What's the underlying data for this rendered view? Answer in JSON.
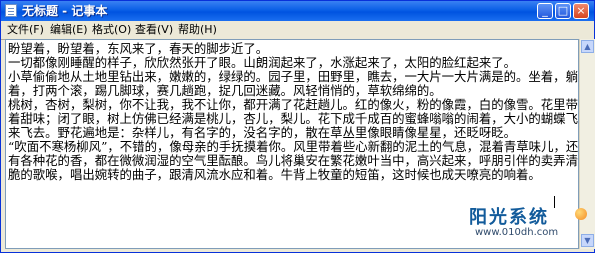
{
  "window": {
    "title": "无标题 - 记事本",
    "controls": {
      "minimize": "_",
      "maximize": "□",
      "close": "×"
    }
  },
  "menu": {
    "items": [
      "文件(F)",
      "编辑(E)",
      "格式(O)",
      "查看(V)",
      "帮助(H)"
    ]
  },
  "document": {
    "lines": [
      "盼望着，盼望着，东风来了，春天的脚步近了。",
      "一切都像刚睡醒的样子，欣欣然张开了眼。山朗润起来了，水涨起来了，太阳的脸红起来了。",
      "小草偷偷地从土地里钻出来，嫩嫩的，绿绿的。园子里，田野里，瞧去，一大片一大片满是的。坐着，躺",
      "着，打两个滚，踢几脚球，赛几趟跑，捉几回迷藏。风轻悄悄的，草软绵绵的。",
      "桃树，杏树，梨树，你不让我，我不让你，都开满了花赶趟儿。红的像火，粉的像霞，白的像雪。花里带",
      "着甜味；闭了眼，树上仿佛已经满是桃儿，杏儿，梨儿。花下成千成百的蜜蜂嗡嗡的闹着，大小的蝴蝶飞",
      "来飞去。野花遍地是：杂样儿，有名字的，没名字的，散在草丛里像眼睛像星星，还眨呀眨。",
      "“吹面不寒杨柳风”，不错的，像母亲的手抚摸着你。风里带着些心新翻的泥土的气息，混着青草味儿，还",
      "有各种花的香，都在微微润湿的空气里酝酿。鸟儿将巢安在繁花嫩叶当中，高兴起来，呼朋引伴的卖弄清",
      "脆的歌喉，唱出婉转的曲子，跟清风流水应和着。牛背上牧童的短笛，这时候也成天嘹亮的响着。"
    ]
  },
  "watermark": {
    "name": "阳光系统",
    "url": "www.010dh.com"
  }
}
